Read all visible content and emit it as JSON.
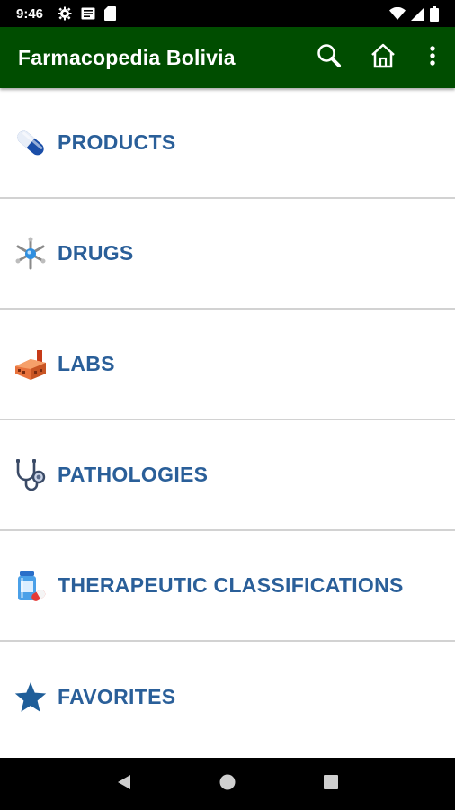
{
  "status_bar": {
    "time": "9:46",
    "left_icons": [
      "settings-icon",
      "notification-icon",
      "sd-card-icon"
    ],
    "right_icons": [
      "wifi-icon",
      "signal-icon",
      "battery-icon"
    ]
  },
  "app_bar": {
    "title": "Farmacopedia Bolivia",
    "background": "#004d00",
    "actions": [
      "search-icon",
      "home-icon",
      "overflow-menu-icon"
    ]
  },
  "menu": {
    "label_color": "#2a5f99",
    "items": [
      {
        "label": "PRODUCTS",
        "icon": "capsule-icon"
      },
      {
        "label": "DRUGS",
        "icon": "molecule-icon"
      },
      {
        "label": "LABS",
        "icon": "factory-icon"
      },
      {
        "label": "PATHOLOGIES",
        "icon": "stethoscope-icon"
      },
      {
        "label": "THERAPEUTIC CLASSIFICATIONS",
        "icon": "medicine-bottle-icon"
      },
      {
        "label": "FAVORITES",
        "icon": "star-icon"
      }
    ]
  },
  "nav_bar": {
    "buttons": [
      "back-icon",
      "home-circle-icon",
      "recents-icon"
    ]
  }
}
